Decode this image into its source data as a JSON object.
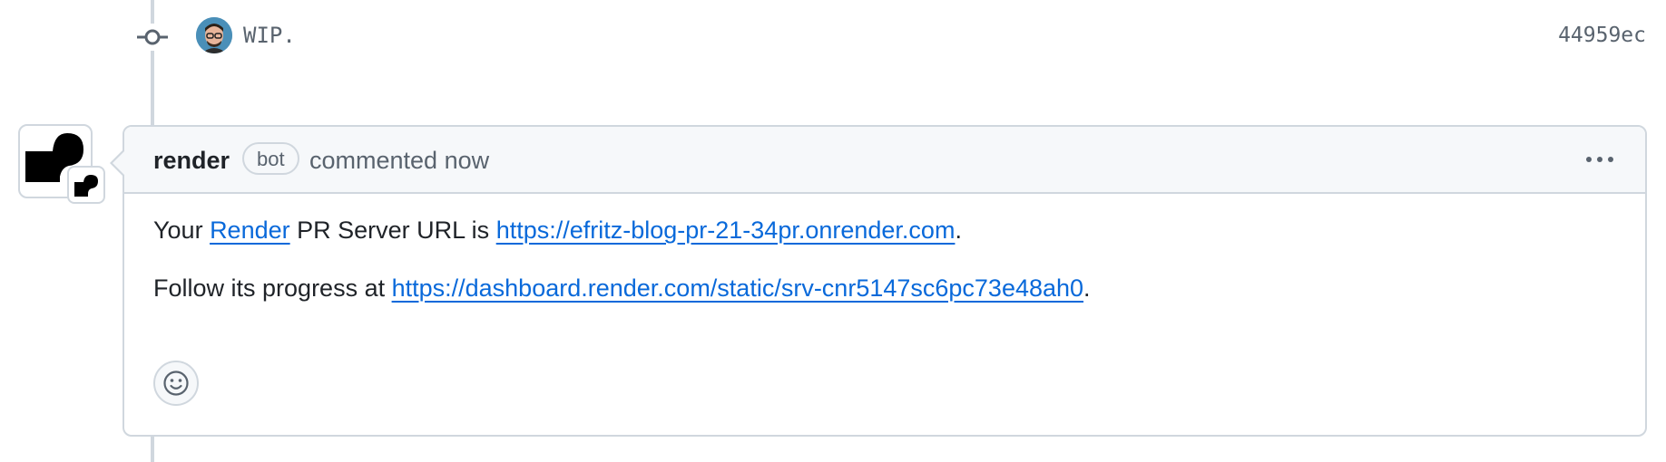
{
  "commit": {
    "message": "WIP.",
    "sha": "44959ec",
    "icon": "git-commit-icon",
    "avatar": "author-avatar"
  },
  "comment": {
    "author": "render",
    "badge": "bot",
    "time": "commented now",
    "menu_icon": "kebab-horizontal-icon",
    "body": {
      "line1_prefix": "Your ",
      "line1_link1": "Render",
      "line1_middle": " PR Server URL is ",
      "line1_link2": "https://efritz-blog-pr-21-34pr.onrender.com",
      "line1_suffix": ".",
      "line2_prefix": "Follow its progress at ",
      "line2_link": "https://dashboard.render.com/static/srv-cnr5147sc6pc73e48ah0",
      "line2_suffix": "."
    },
    "reaction_icon": "smiley-icon"
  },
  "colors": {
    "link": "#0969da",
    "border": "#d0d7de",
    "muted": "#59636e",
    "header_bg": "#f6f8fa"
  }
}
